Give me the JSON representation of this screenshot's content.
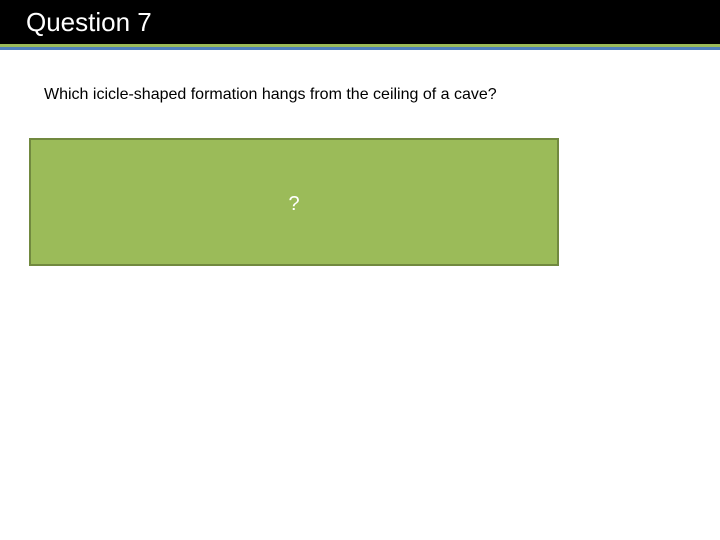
{
  "slide": {
    "title": "Question 7",
    "question": "Which icicle-shaped formation hangs from the ceiling of a cave?",
    "answer_placeholder": "?"
  },
  "colors": {
    "title_bar": "#000000",
    "accent_green": "#9bbb59",
    "accent_blue": "#4f81bd",
    "answer_box_fill": "#9bbb59",
    "answer_box_border": "#71893f"
  }
}
